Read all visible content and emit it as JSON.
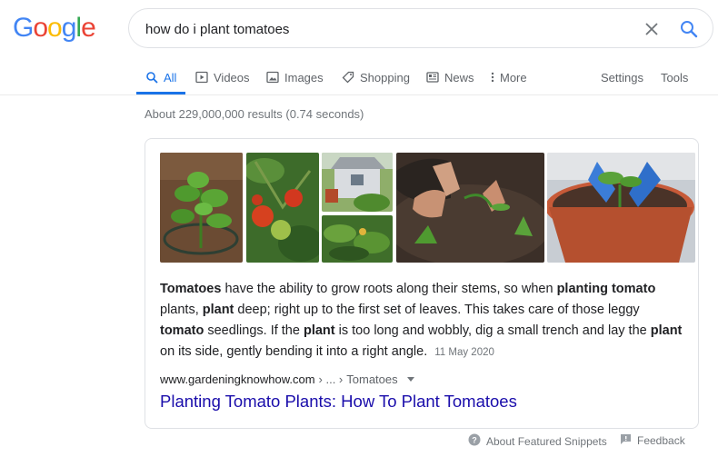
{
  "logo": {
    "letters": [
      "G",
      "o",
      "o",
      "g",
      "l",
      "e"
    ],
    "colors": [
      "#4285F4",
      "#EA4335",
      "#FBBC05",
      "#4285F4",
      "#34A853",
      "#EA4335"
    ]
  },
  "search": {
    "value": "how do i plant tomatoes",
    "clear_icon": "close-icon",
    "search_icon": "search-icon"
  },
  "tabs": [
    {
      "label": "All",
      "icon": "search-icon",
      "active": true
    },
    {
      "label": "Videos",
      "icon": "video-icon"
    },
    {
      "label": "Images",
      "icon": "image-icon"
    },
    {
      "label": "Shopping",
      "icon": "tag-icon"
    },
    {
      "label": "News",
      "icon": "news-icon"
    },
    {
      "label": "More",
      "icon": "more-vert-icon"
    },
    {
      "label": "Settings"
    },
    {
      "label": "Tools"
    }
  ],
  "result_stats": "About 229,000,000 results (0.74 seconds)",
  "snippet": {
    "parts": [
      {
        "bold": true,
        "text": "Tomatoes"
      },
      {
        "bold": false,
        "text": " have the ability to grow roots along their stems, so when "
      },
      {
        "bold": true,
        "text": "planting tomato"
      },
      {
        "bold": false,
        "text": " plants, "
      },
      {
        "bold": true,
        "text": "plant"
      },
      {
        "bold": false,
        "text": " deep; right up to the first set of leaves. This takes care of those leggy "
      },
      {
        "bold": true,
        "text": "tomato"
      },
      {
        "bold": false,
        "text": " seedlings. If the "
      },
      {
        "bold": true,
        "text": "plant"
      },
      {
        "bold": false,
        "text": " is too long and wobbly, dig a small trench and lay the "
      },
      {
        "bold": true,
        "text": "plant"
      },
      {
        "bold": false,
        "text": " on its side, gently bending it into a right angle. "
      }
    ],
    "date": "11 May 2020"
  },
  "cite": {
    "domain": "www.gardeningknowhow.com",
    "sep": " › ... › ",
    "crumb": "Tomatoes"
  },
  "result_title": "Planting Tomato Plants: How To Plant Tomatoes",
  "footer": {
    "about": "About Featured Snippets",
    "feedback": "Feedback"
  }
}
